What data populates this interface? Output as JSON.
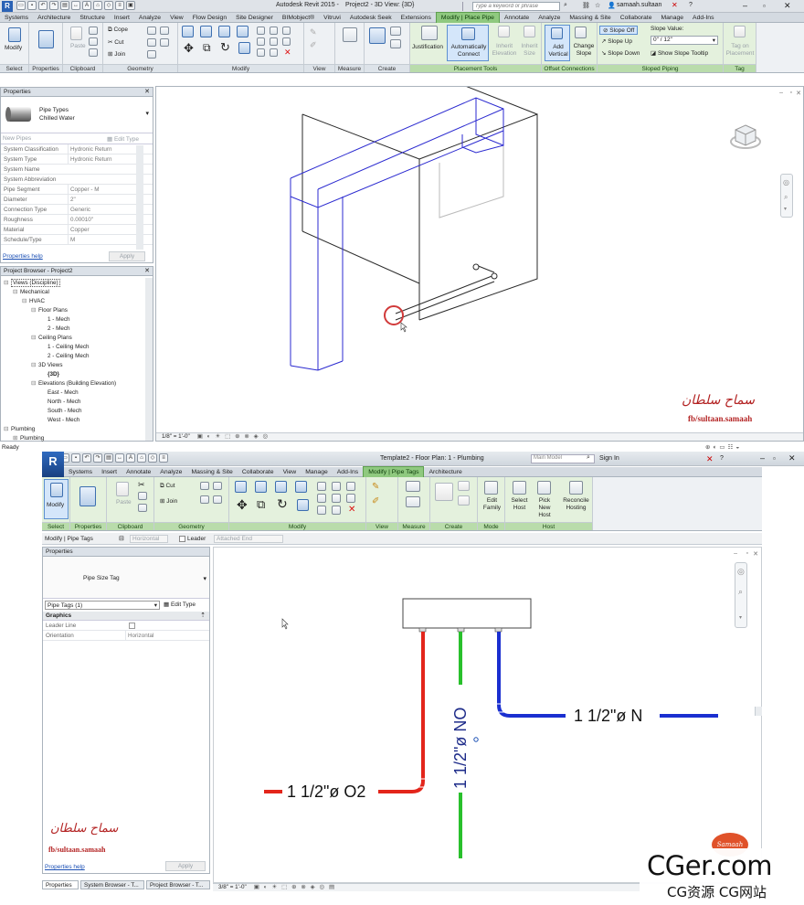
{
  "top": {
    "title_app": "Autodesk Revit 2015 -",
    "title_view": "Project2 - 3D View: {3D}",
    "search_placeholder": "Type a keyword or phrase",
    "user": "samaah.sultaan",
    "tabs": [
      "Systems",
      "Architecture",
      "Structure",
      "Insert",
      "Analyze",
      "View",
      "Flow Design",
      "Site Designer",
      "BIMobject®",
      "Vitruvi",
      "Autodesk Seek",
      "Extensions",
      "Modify | Place Pipe",
      "Annotate",
      "Analyze",
      "Massing & Site",
      "Collaborate",
      "Manage",
      "Add-Ins"
    ],
    "active_tab": "Modify | Place Pipe",
    "ribbon": {
      "modify": "Modify",
      "paste": "Paste",
      "cope": "Cope",
      "cut": "Cut",
      "join": "Join",
      "justification": "Justification",
      "auto_connect": "Automatically Connect",
      "inherit_elevation": "Inherit Elevation",
      "inherit_size": "Inherit Size",
      "add_vertical": "Add Vertical",
      "change_slope": "Change Slope",
      "slope_off": "Slope Off",
      "slope_up": "Slope Up",
      "slope_down": "Slope Down",
      "slope_value_label": "Slope Value:",
      "slope_value": "0\" / 12\"",
      "show_slope_tooltip": "Show Slope Tooltip",
      "tag_on_placement": "Tag on Placement",
      "groups": [
        "Select",
        "Properties",
        "Clipboard",
        "Geometry",
        "Modify",
        "View",
        "Measure",
        "Create",
        "Placement Tools",
        "Offset Connections",
        "Sloped Piping",
        "Tag"
      ]
    },
    "properties": {
      "header": "Properties",
      "type_line1": "Pipe Types",
      "type_line2": "Chilled Water",
      "new_label": "New Pipes",
      "edit_type": "Edit Type",
      "rows": [
        {
          "k": "System Classification",
          "v": "Hydronic Return"
        },
        {
          "k": "System Type",
          "v": "Hydronic Return"
        },
        {
          "k": "System Name",
          "v": ""
        },
        {
          "k": "System Abbreviation",
          "v": ""
        },
        {
          "k": "Pipe Segment",
          "v": "Copper - M"
        },
        {
          "k": "Diameter",
          "v": "2\""
        },
        {
          "k": "Connection Type",
          "v": "Generic"
        },
        {
          "k": "Roughness",
          "v": "0.00010\""
        },
        {
          "k": "Material",
          "v": "Copper"
        },
        {
          "k": "Schedule/Type",
          "v": "M"
        }
      ],
      "help": "Properties help",
      "apply": "Apply"
    },
    "browser": {
      "header": "Project Browser - Project2",
      "items": [
        "Views (Discipline)",
        "Mechanical",
        "HVAC",
        "Floor Plans",
        "1 - Mech",
        "2 - Mech",
        "Ceiling Plans",
        "1 - Ceiling Mech",
        "2 - Ceiling Mech",
        "3D Views",
        "{3D}",
        "Elevations (Building Elevation)",
        "East - Mech",
        "North - Mech",
        "South - Mech",
        "West - Mech",
        "Plumbing",
        "Plumbing"
      ]
    },
    "scale": "1/8\" = 1'-0\"",
    "status": "Ready",
    "watermark_name": "سماح سلطان",
    "watermark_url": "fb/sultaan.samaah"
  },
  "bottom": {
    "title": "Template2 - Floor Plan: 1 - Plumbing",
    "sign_in": "Sign In",
    "tabs": [
      "Systems",
      "Insert",
      "Annotate",
      "Analyze",
      "Massing & Site",
      "Collaborate",
      "View",
      "Manage",
      "Add-Ins",
      "Modify | Pipe Tags",
      "Architecture"
    ],
    "active_tab": "Modify | Pipe Tags",
    "ribbon": {
      "modify": "Modify",
      "paste": "Paste",
      "cut": "Cut",
      "join": "Join",
      "edit_family": "Edit Family",
      "select_host": "Select Host",
      "pick_new_host": "Pick New Host",
      "reconcile_hosting": "Reconcile Hosting",
      "groups": [
        "Select",
        "Properties",
        "Clipboard",
        "Geometry",
        "Modify",
        "View",
        "Measure",
        "Create",
        "Mode",
        "Host"
      ]
    },
    "options": {
      "context": "Modify | Pipe Tags",
      "orientation": "Horizontal",
      "leader": "Leader",
      "attached": "Attached End"
    },
    "properties": {
      "header": "Properties",
      "type_name": "Pipe Size Tag",
      "selector": "Pipe Tags (1)",
      "edit_type": "Edit Type",
      "section": "Graphics",
      "rows": [
        {
          "k": "Leader Line",
          "v": ""
        },
        {
          "k": "Orientation",
          "v": "Horizontal"
        }
      ],
      "help": "Properties help",
      "apply": "Apply"
    },
    "tags": {
      "blue": "1 1/2\"ø N",
      "green": "1 1/2\"ø NO",
      "red": "1 1/2\"ø O2"
    },
    "colors": {
      "red": "#e3251b",
      "green": "#29c02c",
      "blue": "#1a2fd0"
    },
    "scale": "3/8\" = 1'-0\"",
    "bottom_tabs": [
      "Properties",
      "System Browser - T...",
      "Project Browser - T..."
    ],
    "watermark_name": "سماح سلطان",
    "watermark_url": "fb/sultaan.samaah",
    "logo_line1": "CGer.com",
    "logo_line2": "CG资源 CG网站",
    "badge": "Samaah"
  }
}
